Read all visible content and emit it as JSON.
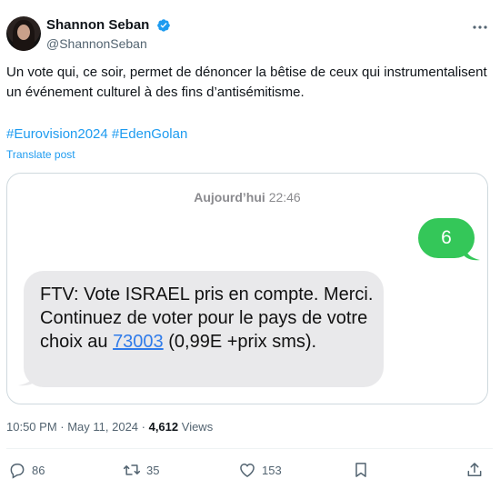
{
  "author": {
    "display_name": "Shannon Seban",
    "handle": "@ShannonSeban"
  },
  "tweet": {
    "text": "Un vote qui, ce soir, permet de dénoncer la bêtise de ceux qui instrumentalisent un événement culturel à des fins d’antisémitisme.",
    "hashtags": [
      "#Eurovision2024",
      "#EdenGolan"
    ],
    "translate_label": "Translate post"
  },
  "sms": {
    "day": "Aujourd’hui",
    "time": "22:46",
    "sent_message": "6",
    "received_before_link": "FTV: Vote ISRAEL  pris en compte. Merci. Continuez de voter pour le pays de votre choix au ",
    "received_link": "73003",
    "received_after_link": " (0,99E +prix sms)."
  },
  "meta": {
    "time": "10:50 PM",
    "separator": " · ",
    "date": "May 11, 2024",
    "views_count": "4,612",
    "views_label": " Views"
  },
  "actions": {
    "replies": "86",
    "reposts": "35",
    "likes": "153"
  },
  "colors": {
    "accent": "#1d9bf0",
    "sms_sent": "#34c759",
    "sms_received": "#e9e9eb",
    "sms_link": "#2f7bea"
  },
  "icons": [
    "verified-badge-icon",
    "more-icon",
    "reply-icon",
    "repost-icon",
    "like-icon",
    "bookmark-icon",
    "share-icon"
  ]
}
